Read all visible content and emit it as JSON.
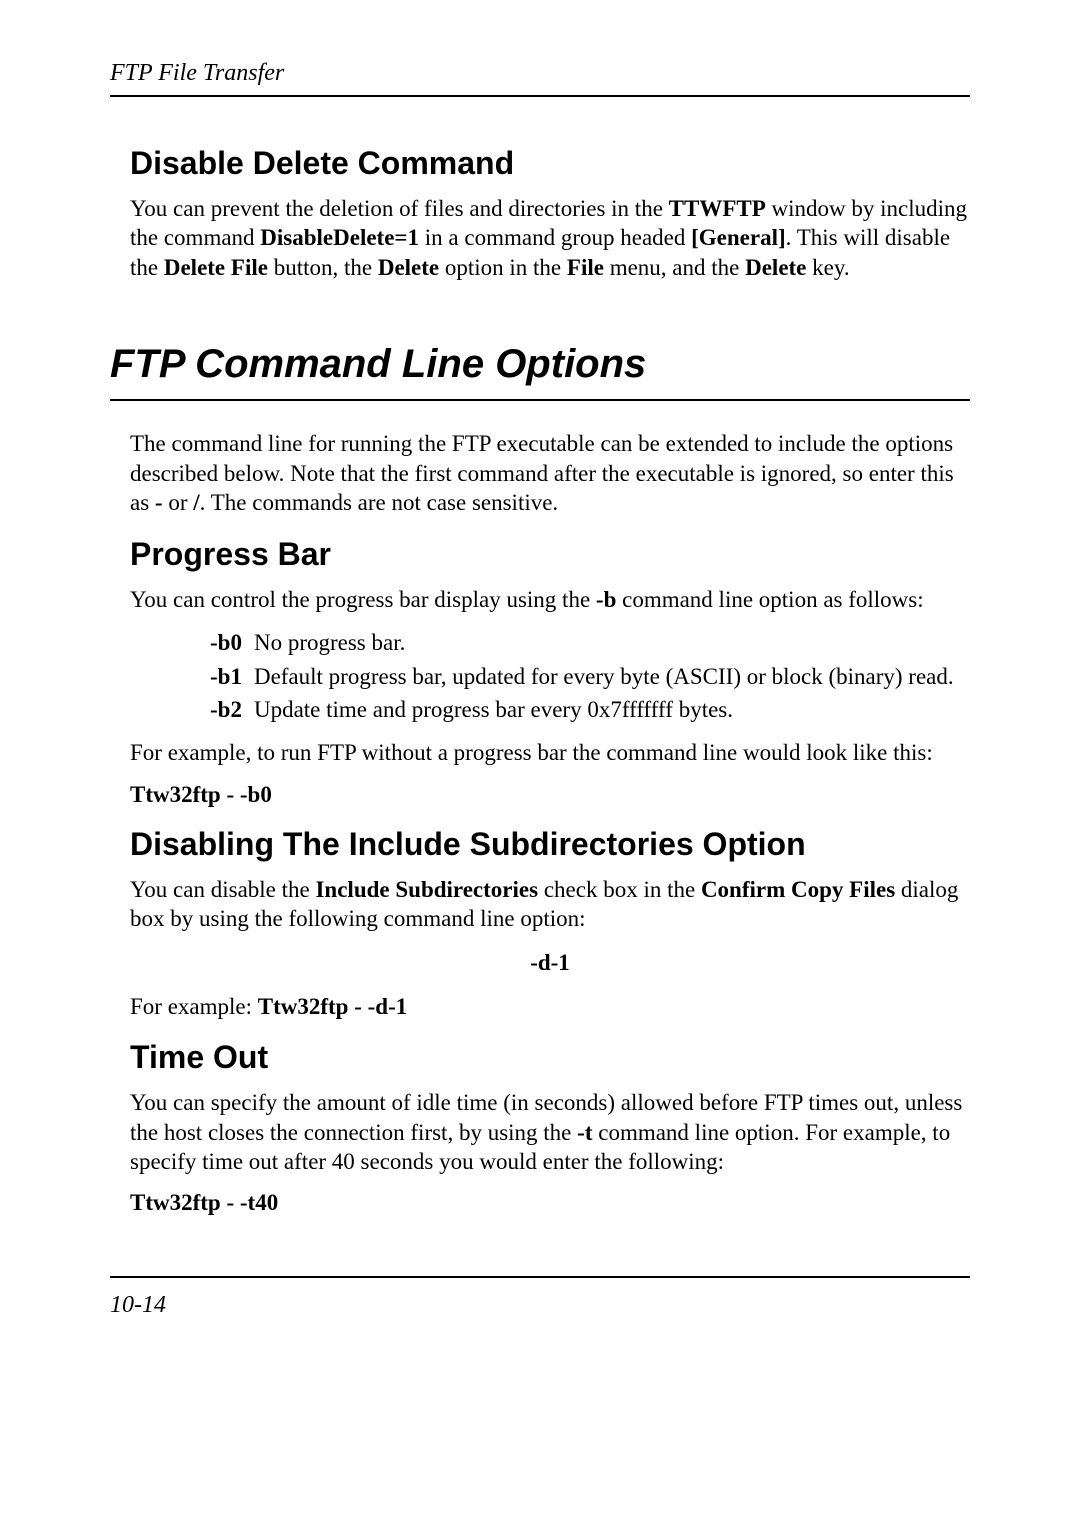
{
  "running_header": "FTP File Transfer",
  "section_disable_delete": {
    "title": "Disable Delete Command",
    "p_pre1": "You can prevent the deletion of files and directories in the ",
    "p_b1": "TTWFTP",
    "p_mid1": " window by including the command ",
    "p_b2": "DisableDelete=1",
    "p_mid2": " in a command group headed ",
    "p_b3": "[General]",
    "p_mid3": ". This will disable the ",
    "p_b4": "Delete File",
    "p_mid4": " button, the ",
    "p_b5": "Delete",
    "p_mid5": " option in the ",
    "p_b6": "File",
    "p_mid6": " menu, and the ",
    "p_b7": "Delete",
    "p_mid7": " key."
  },
  "section_cli": {
    "title": "FTP Command Line Options",
    "p_pre1": "The command line for running the FTP executable can be extended to include the options described below. Note that the first command after the executable is ignored, so enter this as ",
    "p_b1": "-",
    "p_mid1": " or ",
    "p_b2": "/",
    "p_mid2": ". The commands are not case sensitive."
  },
  "section_progress": {
    "title": "Progress Bar",
    "p_pre1": "You can control the progress bar display using the ",
    "p_b1": "-b",
    "p_mid1": " command line option as follows:",
    "opts": [
      {
        "k": "-b0",
        "v": "No progress bar."
      },
      {
        "k": "-b1",
        "v": "Default progress bar, updated for every byte (ASCII) or block (binary) read."
      },
      {
        "k": "-b2",
        "v": "Update time and progress bar every 0x7fffffff bytes."
      }
    ],
    "p2": "For example, to run FTP without a progress bar the command line would look like this:",
    "cmd": "Ttw32ftp  -  -b0"
  },
  "section_subdirs": {
    "title": "Disabling The Include Subdirectories Option",
    "p_pre1": "You can disable the ",
    "p_b1": "Include Subdirectories",
    "p_mid1": " check box in the ",
    "p_b2": "Confirm Copy Files",
    "p_mid2": " dialog box by using the following command line option:",
    "opt": "-d-1",
    "ex_label": "For example:  ",
    "ex_cmd": "Ttw32ftp  -  -d-1"
  },
  "section_timeout": {
    "title": "Time Out",
    "p_pre1": "You can specify the amount of idle time (in seconds) allowed before FTP times out, unless the host closes the connection first, by using the ",
    "p_b1": "-t",
    "p_mid1": " command line option. For example, to specify time out after 40 seconds you would enter the following:",
    "cmd": "Ttw32ftp  -  -t40"
  },
  "page_number": "10-14"
}
